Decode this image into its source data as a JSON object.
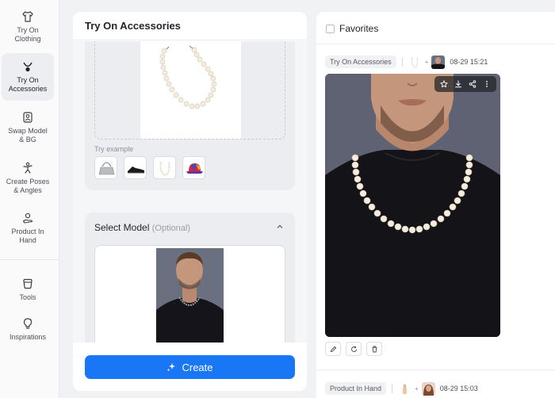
{
  "sidebar": {
    "items": [
      {
        "label": "Try On\nClothing",
        "icon": "shirt-icon"
      },
      {
        "label": "Try On\nAccessories",
        "icon": "necklace-icon"
      },
      {
        "label": "Swap Model\n& BG",
        "icon": "swap-icon"
      },
      {
        "label": "Create Poses\n& Angles",
        "icon": "pose-icon"
      },
      {
        "label": "Product In\nHand",
        "icon": "hand-icon"
      },
      {
        "label": "Tools",
        "icon": "tools-icon"
      },
      {
        "label": "Inspirations",
        "icon": "bulb-icon"
      }
    ],
    "active_index": 1
  },
  "panel": {
    "title": "Try On Accessories",
    "try_example_label": "Try example",
    "examples": [
      "bag",
      "shoe",
      "necklace",
      "hat"
    ],
    "select_model_title": "Select Model",
    "select_model_optional": "(Optional)",
    "create_label": "Create"
  },
  "right": {
    "favorites_label": "Favorites",
    "entries": [
      {
        "tag": "Try On Accessories",
        "time": "08-29 15:21"
      },
      {
        "tag": "Product In Hand",
        "time": "08-29 15:03"
      }
    ]
  },
  "colors": {
    "accent": "#1976f5",
    "sidebar_bg": "#fafafb",
    "page_bg": "#f1f2f4"
  }
}
